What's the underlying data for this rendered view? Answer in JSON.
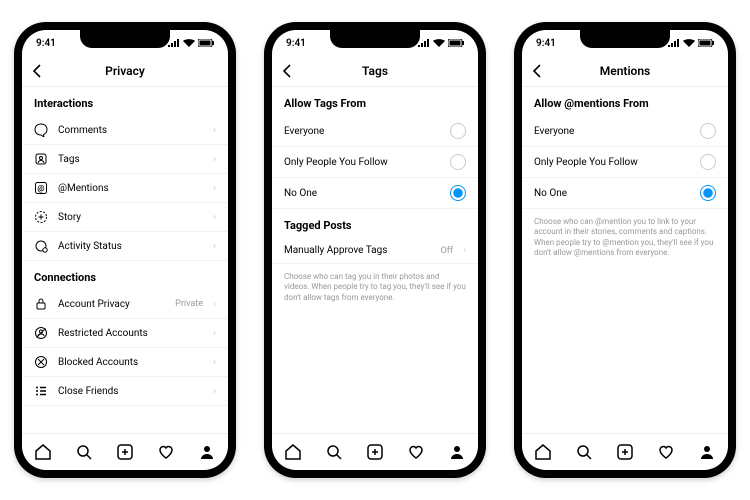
{
  "status_time": "9:41",
  "phones": [
    {
      "title": "Privacy",
      "sections": [
        {
          "title": "Interactions",
          "rows": [
            {
              "icon": "comment",
              "label": "Comments"
            },
            {
              "icon": "tag",
              "label": "Tags"
            },
            {
              "icon": "mention",
              "label": "@Mentions"
            },
            {
              "icon": "story",
              "label": "Story"
            },
            {
              "icon": "activity",
              "label": "Activity Status"
            }
          ]
        },
        {
          "title": "Connections",
          "rows": [
            {
              "icon": "lock",
              "label": "Account Privacy",
              "value": "Private"
            },
            {
              "icon": "restricted",
              "label": "Restricted Accounts"
            },
            {
              "icon": "blocked",
              "label": "Blocked Accounts"
            },
            {
              "icon": "list",
              "label": "Close Friends"
            }
          ]
        }
      ]
    },
    {
      "title": "Tags",
      "allow_title": "Allow Tags From",
      "options": [
        {
          "label": "Everyone",
          "selected": false
        },
        {
          "label": "Only People You Follow",
          "selected": false
        },
        {
          "label": "No One",
          "selected": true
        }
      ],
      "sub_section_title": "Tagged Posts",
      "sub_row": {
        "label": "Manually Approve Tags",
        "value": "Off"
      },
      "helper": "Choose who can tag you in their photos and videos. When people try to tag you, they'll see if you don't allow tags from everyone."
    },
    {
      "title": "Mentions",
      "allow_title": "Allow @mentions From",
      "options": [
        {
          "label": "Everyone",
          "selected": false
        },
        {
          "label": "Only People You Follow",
          "selected": false
        },
        {
          "label": "No One",
          "selected": true
        }
      ],
      "helper": "Choose who can @mention you to link to your account in their stories, comments and captions. When people try to @mention you, they'll see if you don't allow @mentions from everyone."
    }
  ]
}
